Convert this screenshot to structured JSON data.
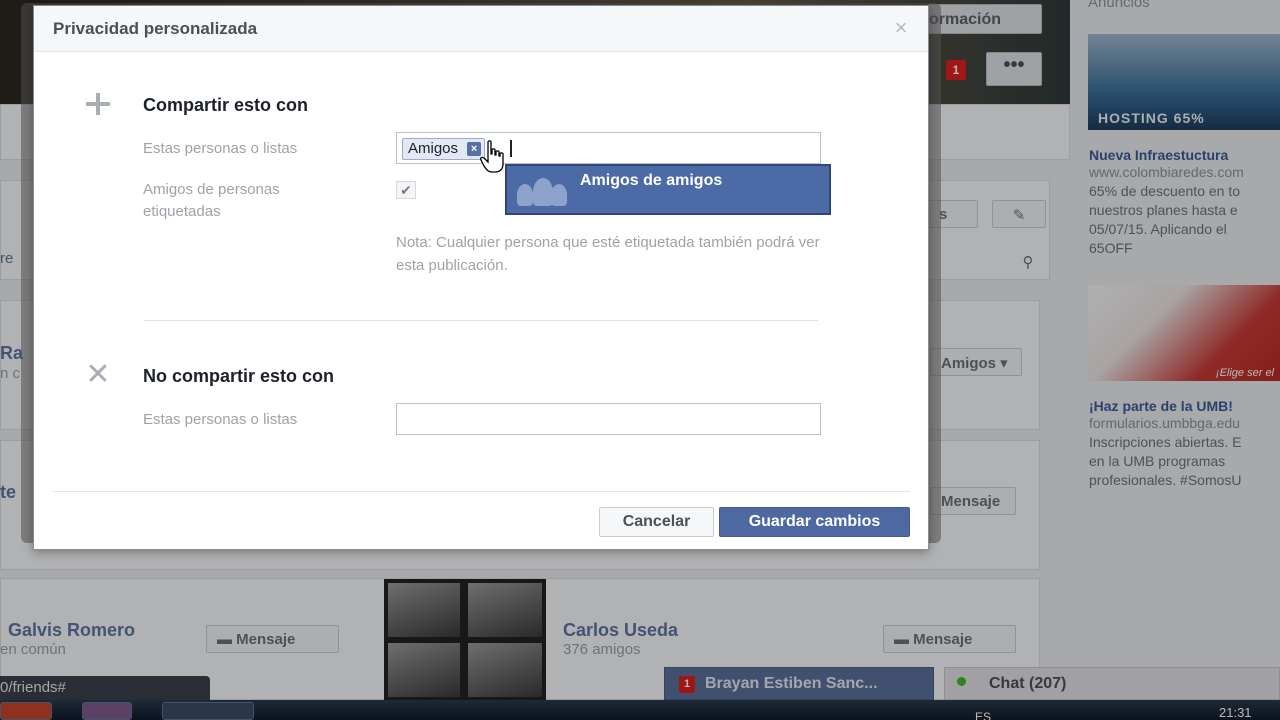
{
  "background": {
    "cover": {
      "info_button_label": "ormación",
      "notification_count": "1",
      "more_label": "•••"
    },
    "ads": {
      "header": "Anuncios",
      "items": [
        {
          "image_text": "HOSTING 65%",
          "title": "Nueva Infraestuctura",
          "url": "www.colombiaredes.com",
          "text": "65% de descuento en to\nnuestros planes hasta e\n05/07/15. Aplicando el\n65OFF"
        },
        {
          "image_text": "¡Elige ser el",
          "title": "¡Haz parte de la UMB!",
          "url": "formularios.umbbga.edu",
          "text": "Inscripciones abiertas. E\nen la UMB programas\nprofesionales. #SomosU"
        }
      ]
    },
    "friends": [
      {
        "name": "Galvis Romero",
        "sub": "en común",
        "button": "Mensaje"
      },
      {
        "name": "Carlos Useda",
        "sub": "376 amigos",
        "button": "Mensaje"
      }
    ],
    "partial_labels": {
      "amigos_button": "Amigos",
      "mensaje_button": "Mensaje",
      "left_r": "Ra",
      "left_n": "n c",
      "left_re": "re",
      "left_te": "te",
      "edit_s": "s"
    },
    "status_url": "0/friends#",
    "chat_tab_name": "Brayan Estiben Sanc...",
    "chat_tab_badge": "1",
    "chat_label": "Chat (207)",
    "taskbar": {
      "lang": "ES",
      "clock": "21:31"
    }
  },
  "dialog": {
    "title": "Privacidad personalizada",
    "close_glyph": "×",
    "share_section": {
      "title": "Compartir esto con",
      "people_label": "Estas personas o listas",
      "token": "Amigos",
      "token_remove": "×",
      "suggestion": "Amigos de amigos",
      "tagged_label": "Amigos de personas\netiquetadas",
      "tagged_checked": true,
      "check_glyph": "✔",
      "note": "Nota: Cualquier persona que esté etiquetada también podrá ver esta publicación."
    },
    "no_share_section": {
      "title": "No compartir esto con",
      "people_label": "Estas personas o listas",
      "input_value": ""
    },
    "buttons": {
      "cancel": "Cancelar",
      "save": "Guardar cambios"
    }
  }
}
